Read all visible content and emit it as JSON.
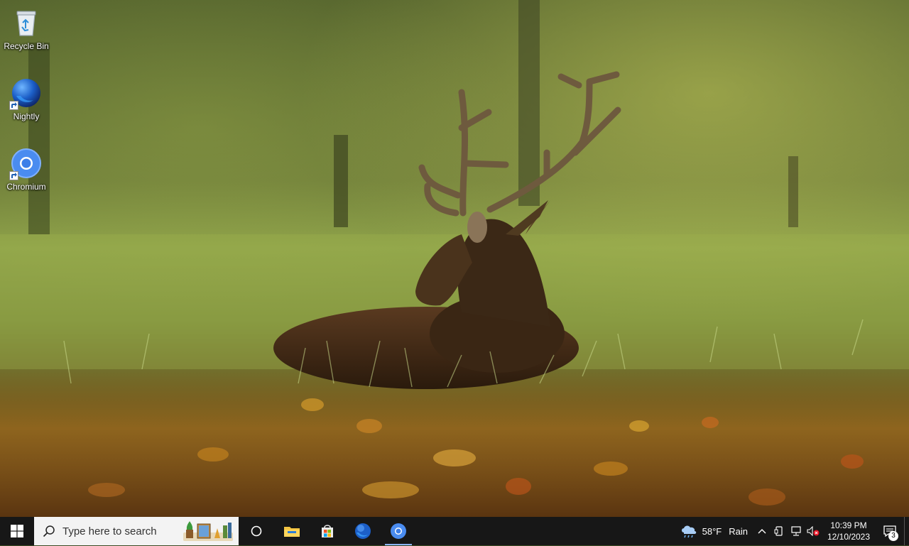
{
  "desktop": {
    "icons": [
      {
        "label": "Recycle Bin",
        "icon": "recycle-bin-icon"
      },
      {
        "label": "Nightly",
        "icon": "firefox-nightly-icon"
      },
      {
        "label": "Chromium",
        "icon": "chromium-icon"
      }
    ]
  },
  "taskbar": {
    "start_icon": "windows-logo-icon",
    "search": {
      "placeholder": "Type here to search"
    },
    "apps": [
      {
        "name": "Task View",
        "icon": "task-view-icon"
      },
      {
        "name": "File Explorer",
        "icon": "file-explorer-icon"
      },
      {
        "name": "Microsoft Store",
        "icon": "store-icon"
      },
      {
        "name": "Nightly",
        "icon": "firefox-nightly-icon"
      },
      {
        "name": "Chromium",
        "icon": "chromium-icon",
        "active": true
      }
    ],
    "tray": {
      "weather": {
        "temp": "58°F",
        "condition": "Rain"
      },
      "clock": {
        "time": "10:39 PM",
        "date": "12/10/2023"
      },
      "notifications": {
        "count": "3"
      }
    }
  },
  "colors": {
    "taskbar_bg": "#171717",
    "search_bg": "#f3f3f3",
    "chromium_blue": "#4a8cf0",
    "active_indicator": "#8ab4f8"
  }
}
